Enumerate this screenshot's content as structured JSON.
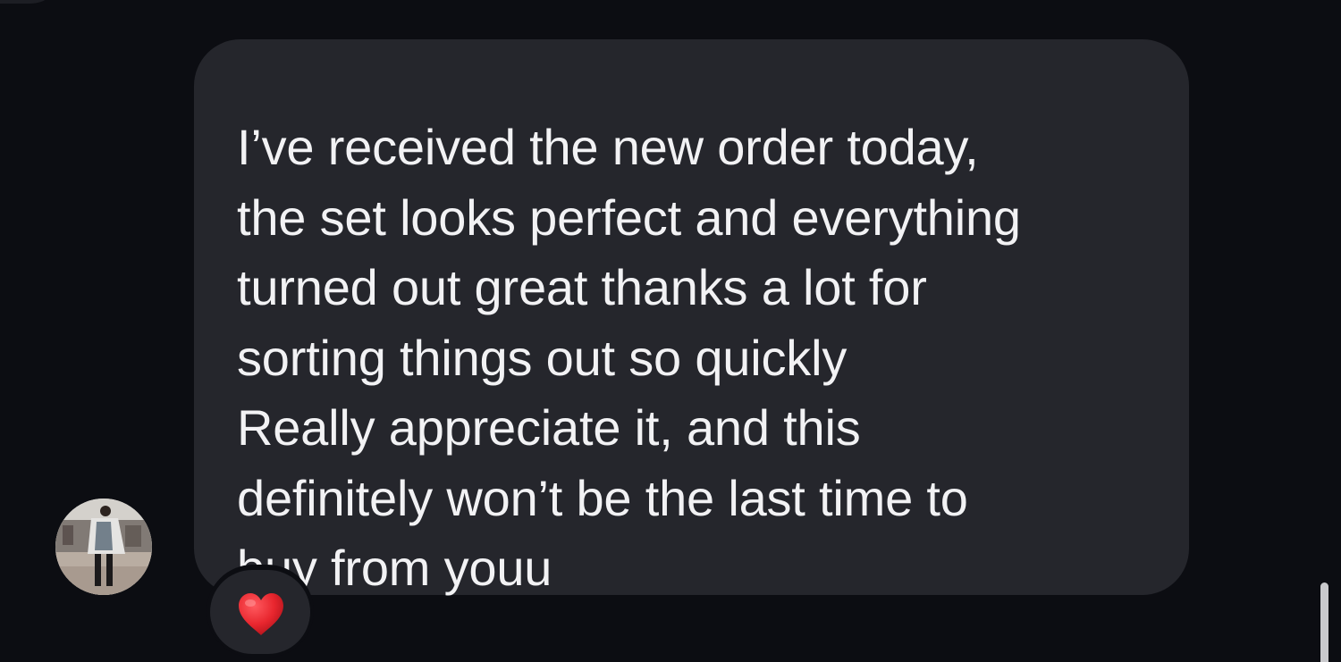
{
  "message": {
    "lines": [
      "I’ve received the new order today,",
      "the set looks perfect and everything",
      "turned out great thanks a lot for",
      "sorting things out so quickly",
      "Really appreciate it, and this",
      "definitely won’t be the last time to",
      "buy from youu"
    ]
  },
  "reaction": {
    "icon": "red-heart-icon",
    "color": "#e8262e"
  },
  "colors": {
    "background": "#0c0d12",
    "bubble": "#25262c",
    "text": "#f2f2f4"
  }
}
